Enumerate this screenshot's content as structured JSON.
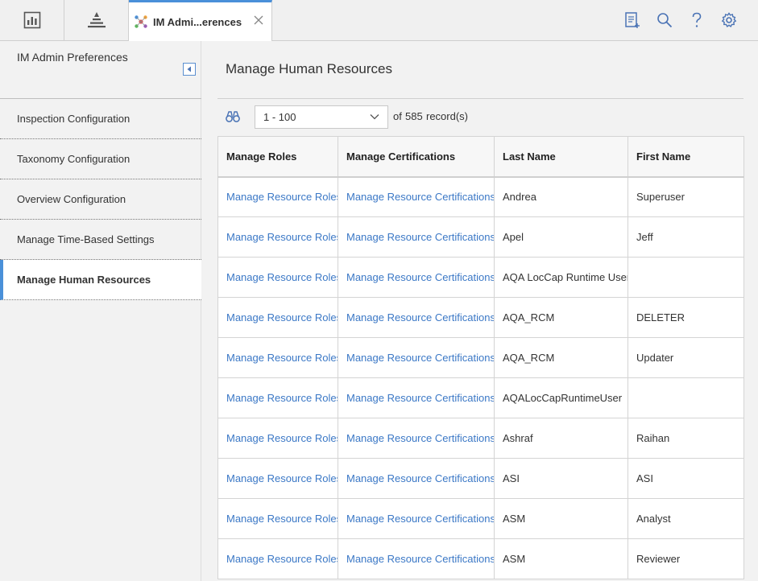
{
  "tabs": {
    "active_label": "IM Admi...erences"
  },
  "icons": {
    "reports": "reports-icon",
    "strategy": "strategy-pyramid-icon",
    "tab": "hub-icon",
    "close": "close-icon",
    "notes": "notes-icon",
    "search": "search-icon",
    "help": "help-icon",
    "settings": "gear-icon"
  },
  "left_panel": {
    "title": "IM Admin Preferences",
    "items": [
      {
        "label": "Inspection Configuration",
        "active": false
      },
      {
        "label": "Taxonomy Configuration",
        "active": false
      },
      {
        "label": "Overview Configuration",
        "active": false
      },
      {
        "label": "Manage Time-Based Settings",
        "active": false
      },
      {
        "label": "Manage Human Resources",
        "active": true
      }
    ]
  },
  "main": {
    "title": "Manage Human Resources",
    "pager": {
      "range": "1 - 100",
      "of_label": "of",
      "count": "585",
      "records_label": "record(s)"
    },
    "columns": [
      "Manage Roles",
      "Manage Certifications",
      "Last Name",
      "First Name"
    ],
    "rows": [
      {
        "roles": "Manage Resource Roles",
        "certs": "Manage Resource Certifications",
        "last": "Andrea",
        "first": "Superuser"
      },
      {
        "roles": "Manage Resource Roles",
        "certs": "Manage Resource Certifications",
        "last": "Apel",
        "first": "Jeff"
      },
      {
        "roles": "Manage Resource Roles",
        "certs": "Manage Resource Certifications",
        "last": "AQA LocCap Runtime User",
        "first": ""
      },
      {
        "roles": "Manage Resource Roles",
        "certs": "Manage Resource Certifications",
        "last": "AQA_RCM",
        "first": "DELETER"
      },
      {
        "roles": "Manage Resource Roles",
        "certs": "Manage Resource Certifications",
        "last": "AQA_RCM",
        "first": "Updater"
      },
      {
        "roles": "Manage Resource Roles",
        "certs": "Manage Resource Certifications",
        "last": "AQALocCapRuntimeUser",
        "first": ""
      },
      {
        "roles": "Manage Resource Roles",
        "certs": "Manage Resource Certifications",
        "last": "Ashraf",
        "first": "Raihan"
      },
      {
        "roles": "Manage Resource Roles",
        "certs": "Manage Resource Certifications",
        "last": "ASI",
        "first": "ASI"
      },
      {
        "roles": "Manage Resource Roles",
        "certs": "Manage Resource Certifications",
        "last": "ASM",
        "first": "Analyst"
      },
      {
        "roles": "Manage Resource Roles",
        "certs": "Manage Resource Certifications",
        "last": "ASM",
        "first": "Reviewer"
      }
    ]
  },
  "colors": {
    "accent": "#4a90d9",
    "link": "#3b78c6",
    "icon": "#4a73b5"
  }
}
